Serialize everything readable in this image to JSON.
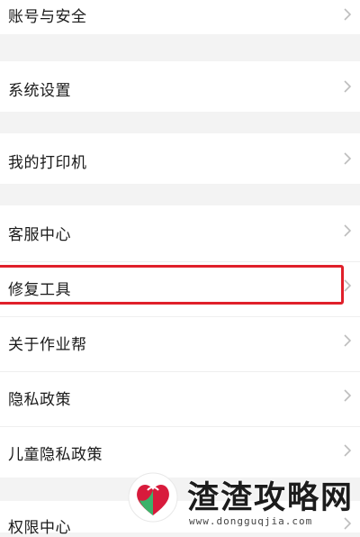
{
  "settings_menu": {
    "items": [
      {
        "label": "账号与安全"
      },
      {
        "label": "系统设置"
      },
      {
        "label": "我的打印机"
      },
      {
        "label": "客服中心"
      },
      {
        "label": "修复工具",
        "highlighted": true
      },
      {
        "label": "关于作业帮"
      },
      {
        "label": "隐私政策"
      },
      {
        "label": "儿童隐私政策"
      },
      {
        "label": "权限中心"
      }
    ]
  },
  "highlight_color": "#e0202a",
  "watermark": {
    "name": "渣渣攻略网",
    "url": "www.dongguqjia.com"
  }
}
